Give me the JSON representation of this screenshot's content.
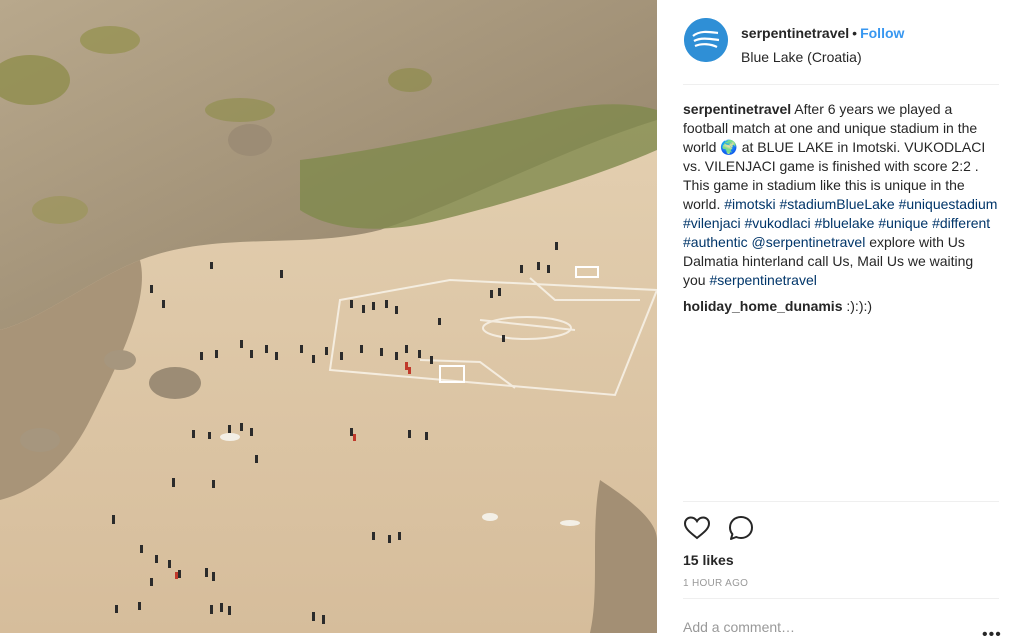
{
  "post": {
    "username": "serpentinetravel",
    "separator": "•",
    "follow_label": "Follow",
    "location": "Blue Lake (Croatia)",
    "caption": {
      "username": "serpentinetravel",
      "text_1": "After 6 years we played a football match at one and unique stadium in the world",
      "emoji": "🌍",
      "text_2": "at BLUE LAKE in Imotski. VUKODLACI vs. VILENJACI game is finished with score 2:2 . This game in stadium like this is unique in the world.",
      "tags_1": [
        "#imotski",
        "#stadiumBlueLake",
        "#uniquestadium",
        "#vilenjaci",
        "#vukodlaci",
        "#bluelake",
        "#unique",
        "#different",
        "#authentic",
        "@serpentinetravel"
      ],
      "text_3": "explore with Us Dalmatia hinterland call Us, Mail Us we waiting you",
      "tag_final": "#serpentinetravel"
    },
    "comments": [
      {
        "username": "holiday_home_dunamis",
        "text": ":):):)"
      }
    ],
    "likes": "15 likes",
    "time": "1 HOUR AGO",
    "add_comment_placeholder": "Add a comment…",
    "more_label": "•••"
  },
  "icons": {
    "like": "heart-icon",
    "comment": "comment-bubble-icon",
    "avatar": "serpentine-logo"
  },
  "colors": {
    "link": "#3897f0",
    "hashtag": "#003569",
    "avatar": "#2f8fd6",
    "muted": "#999999"
  }
}
